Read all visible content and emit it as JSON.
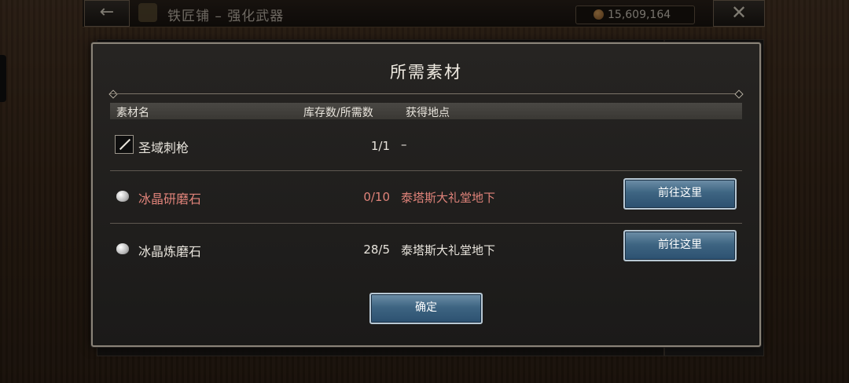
{
  "topbar": {
    "back_icon": "arrow-left-icon",
    "title": "铁匠铺 – 强化武器",
    "currency_value": "15,609,164",
    "close_icon": "close-icon"
  },
  "modal": {
    "title": "所需素材",
    "columns": [
      "素材名",
      "库存数/所需数",
      "获得地点"
    ],
    "rows": [
      {
        "name": "圣域刺枪",
        "icon": "spear-icon",
        "count": "1/1",
        "location": "–",
        "button": null,
        "insufficient": false
      },
      {
        "name": "冰晶研磨石",
        "icon": "whetstone-icon",
        "count": "0/10",
        "location": "泰塔斯大礼堂地下",
        "button": "前往这里",
        "insufficient": true
      },
      {
        "name": "冰晶炼磨石",
        "icon": "whetstone-icon",
        "count": "28/5",
        "location": "泰塔斯大礼堂地下",
        "button": "前往这里",
        "insufficient": false
      }
    ],
    "confirm_label": "确定"
  },
  "colors": {
    "insufficient_text": "#e0837a",
    "button_blue": "#3e6582",
    "modal_border": "#8a8378"
  }
}
